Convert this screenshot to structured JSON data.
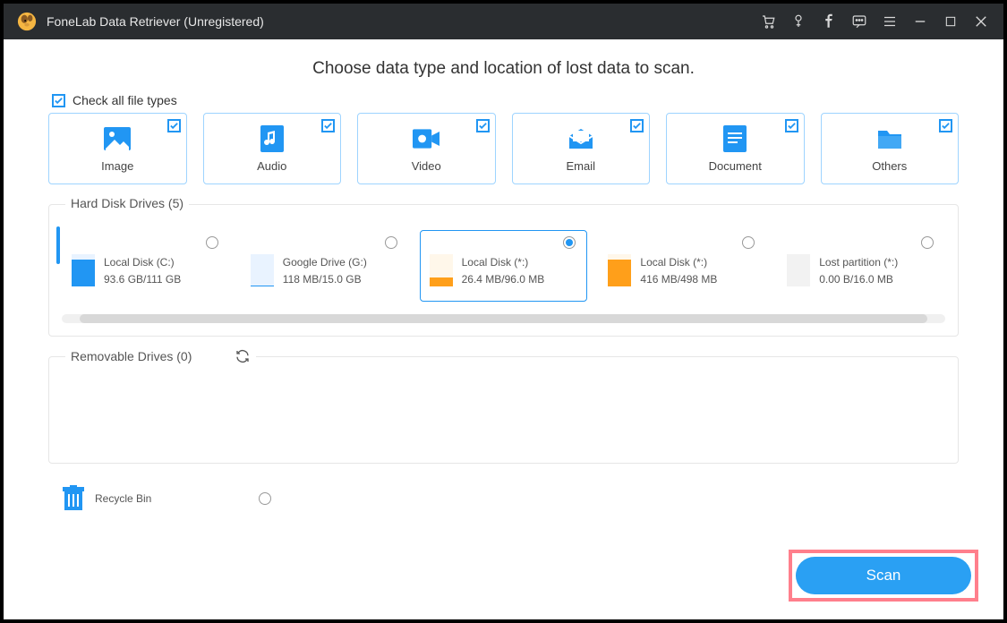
{
  "titlebar": {
    "title": "FoneLab Data Retriever (Unregistered)"
  },
  "headline": "Choose data type and location of lost data to scan.",
  "check_all_label": "Check all file types",
  "types": [
    {
      "label": "Image"
    },
    {
      "label": "Audio"
    },
    {
      "label": "Video"
    },
    {
      "label": "Email"
    },
    {
      "label": "Document"
    },
    {
      "label": "Others"
    }
  ],
  "hard_disk": {
    "title": "Hard Disk Drives (5)",
    "drives": [
      {
        "name": "Local Disk (C:)",
        "usage": "93.6 GB/111 GB",
        "color": "blue",
        "fill_pct": 84,
        "selected": false
      },
      {
        "name": "Google Drive (G:)",
        "usage": "118 MB/15.0 GB",
        "color": "blue",
        "fill_pct": 2,
        "selected": false
      },
      {
        "name": "Local Disk (*:)",
        "usage": "26.4 MB/96.0 MB",
        "color": "orange",
        "fill_pct": 28,
        "selected": true
      },
      {
        "name": "Local Disk (*:)",
        "usage": "416 MB/498 MB",
        "color": "orange",
        "fill_pct": 84,
        "selected": false
      },
      {
        "name": "Lost partition (*:)",
        "usage": "0.00  B/16.0 MB",
        "color": "gray",
        "fill_pct": 0,
        "selected": false
      }
    ]
  },
  "removable": {
    "title": "Removable Drives (0)"
  },
  "recycle_bin": {
    "label": "Recycle Bin"
  },
  "scan_label": "Scan"
}
